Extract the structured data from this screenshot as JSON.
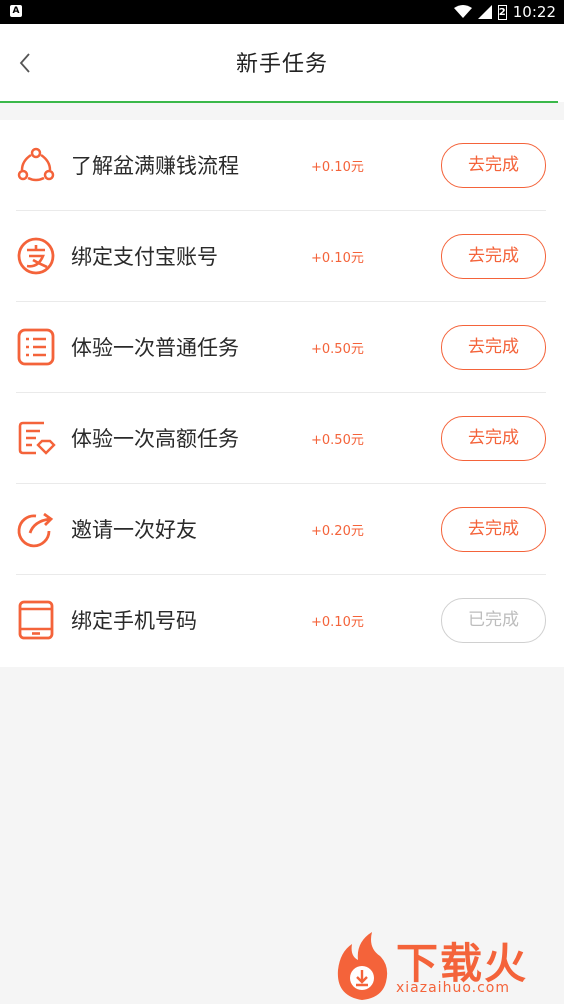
{
  "status_bar": {
    "left_badge": "A",
    "time": "10:22",
    "battery_level": "2"
  },
  "header": {
    "title": "新手任务"
  },
  "tasks": [
    {
      "label": "了解盆满赚钱流程",
      "reward": "+0.10元",
      "button": "去完成",
      "completed": false,
      "icon": "share-flow-icon"
    },
    {
      "label": "绑定支付宝账号",
      "reward": "+0.10元",
      "button": "去完成",
      "completed": false,
      "icon": "alipay-icon"
    },
    {
      "label": "体验一次普通任务",
      "reward": "+0.50元",
      "button": "去完成",
      "completed": false,
      "icon": "task-list-icon"
    },
    {
      "label": "体验一次高额任务",
      "reward": "+0.50元",
      "button": "去完成",
      "completed": false,
      "icon": "premium-task-icon"
    },
    {
      "label": "邀请一次好友",
      "reward": "+0.20元",
      "button": "去完成",
      "completed": false,
      "icon": "invite-share-icon"
    },
    {
      "label": "绑定手机号码",
      "reward": "+0.10元",
      "button": "已完成",
      "completed": true,
      "icon": "phone-icon"
    }
  ],
  "watermark": {
    "title": "下载火",
    "subtitle": "xiazaihuo.com"
  },
  "colors": {
    "accent": "#f4633a",
    "header_line": "#3bb84a",
    "done_border": "#d0d0d0"
  }
}
